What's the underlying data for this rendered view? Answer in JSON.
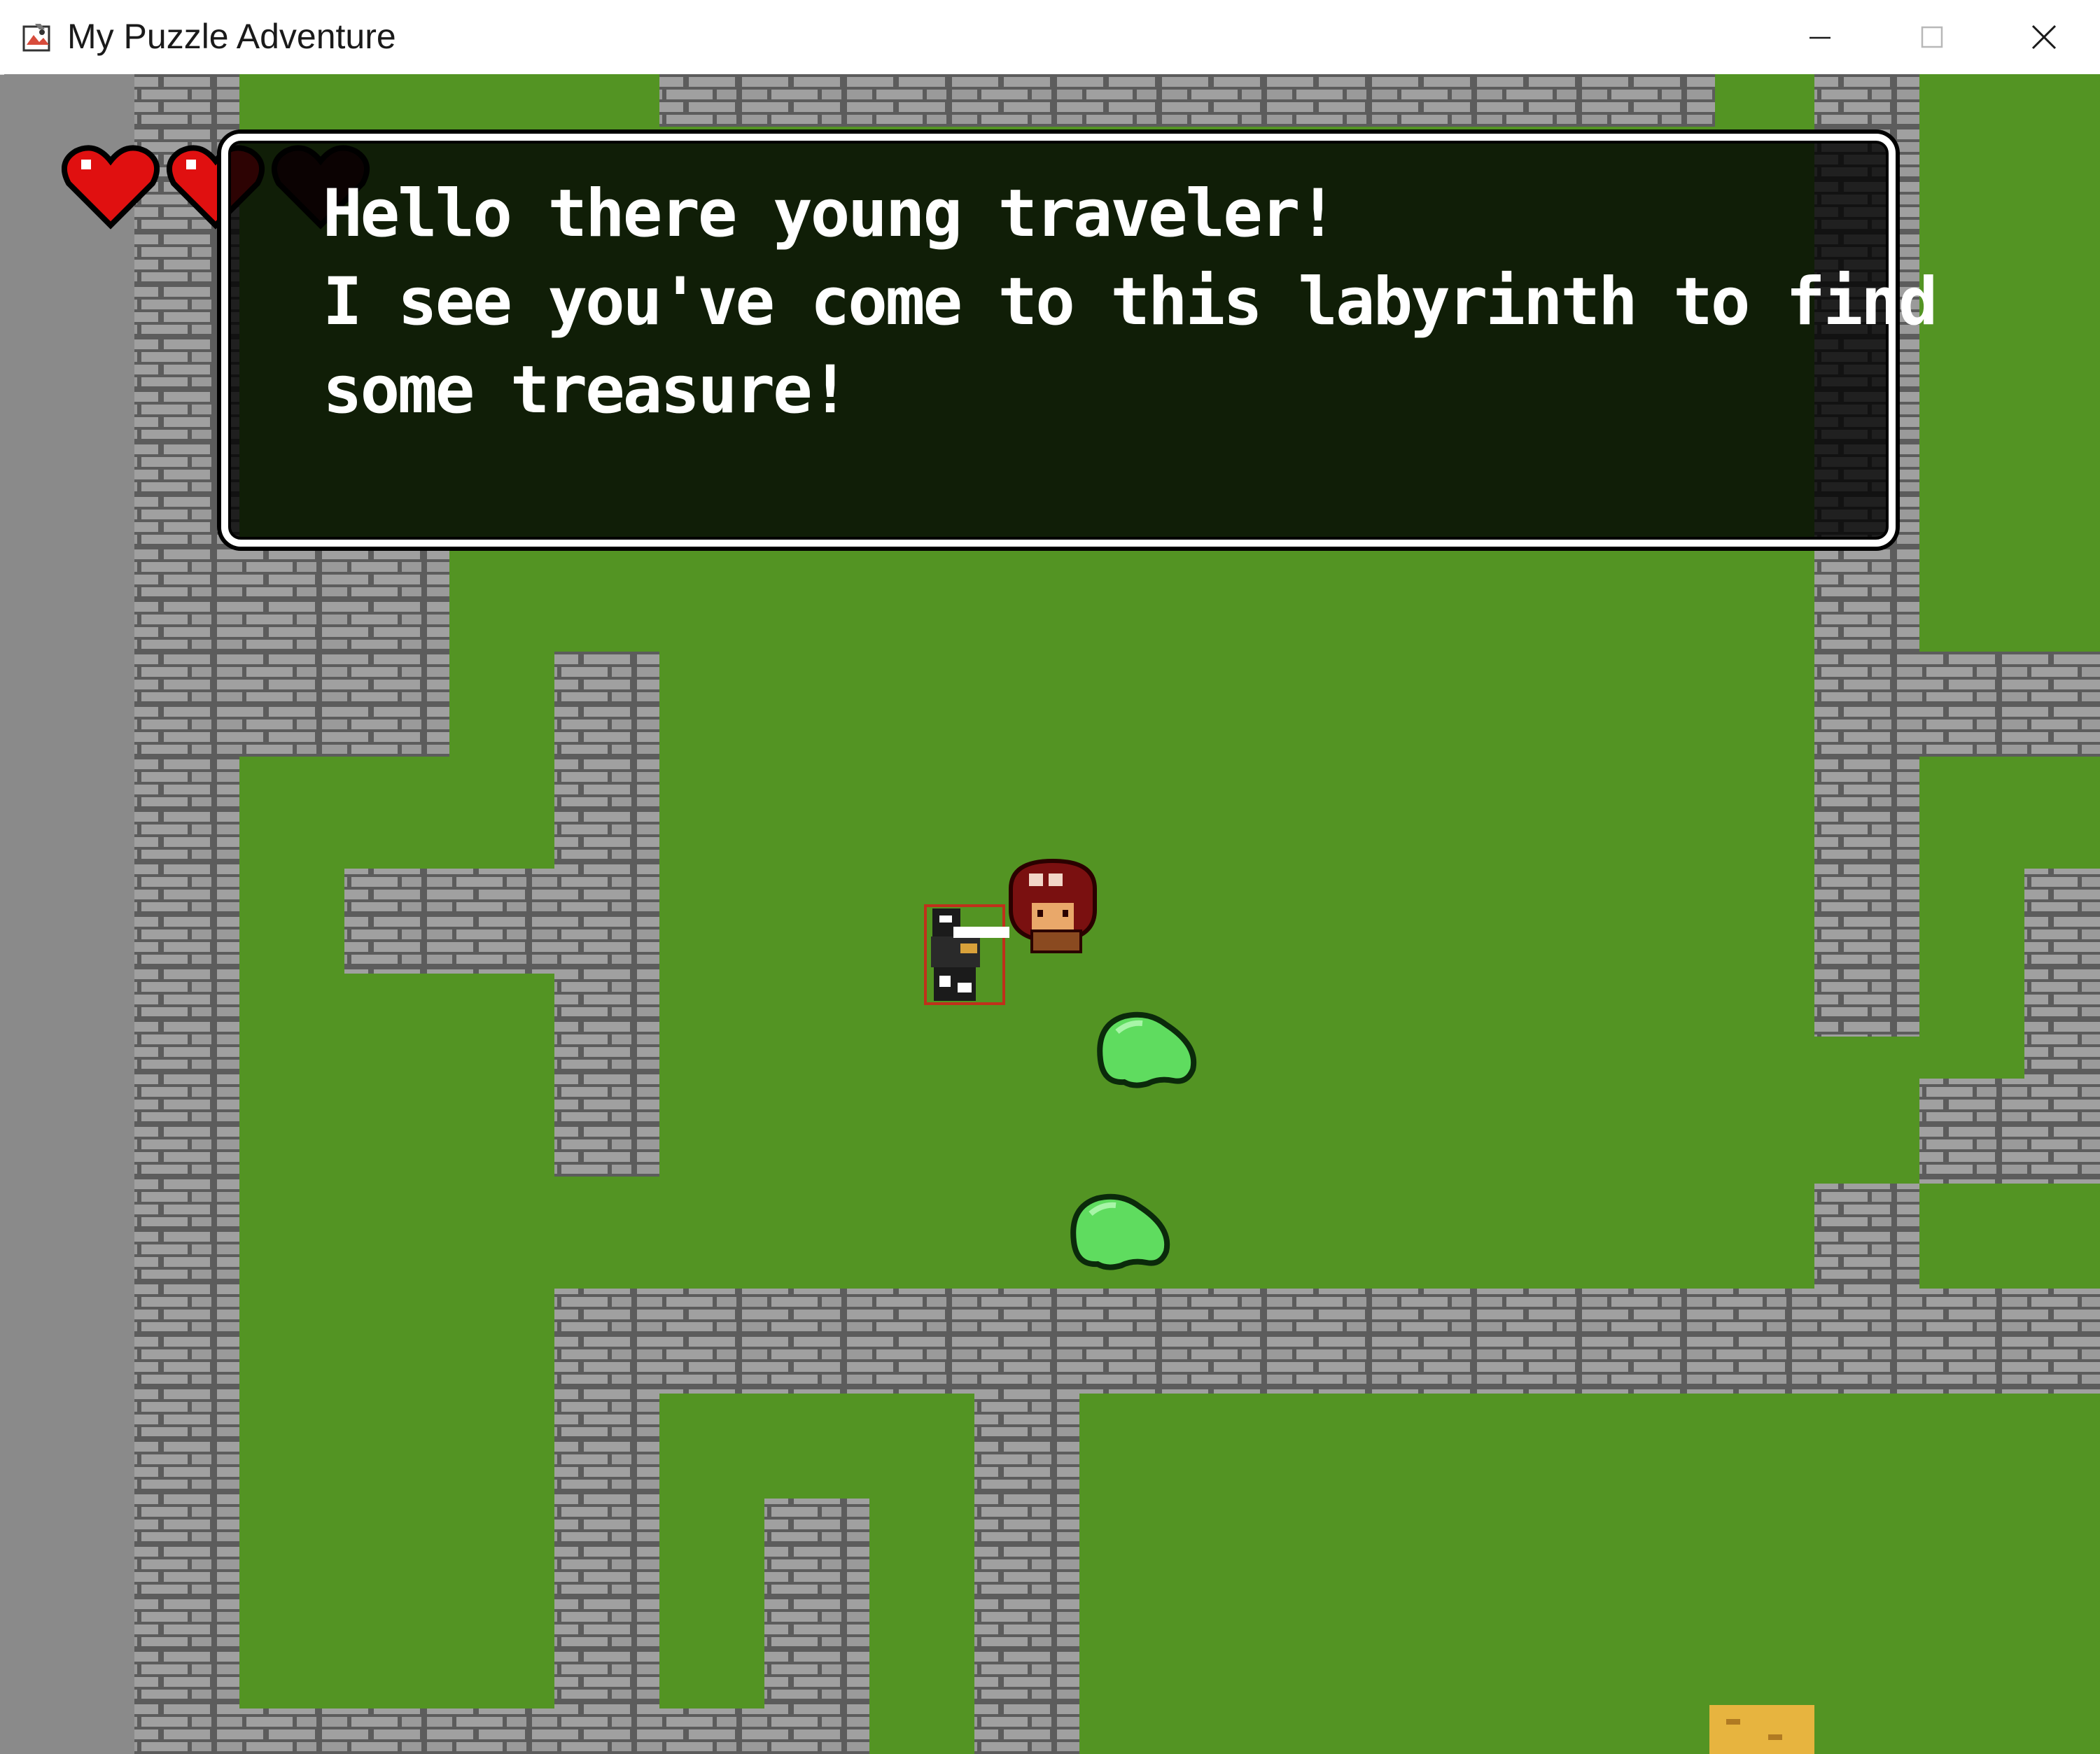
{
  "window": {
    "title": "My Puzzle Adventure",
    "controls": {
      "minimize_icon": "minimize-icon",
      "maximize_icon": "maximize-icon",
      "close_icon": "close-icon"
    }
  },
  "hud": {
    "hearts_total": 3,
    "hearts_filled": 2,
    "heart_color": "#e01010",
    "heart_empty_color": "#3a0a0a"
  },
  "dialog": {
    "lines": [
      "Hello there young traveler!",
      "I see you've come to this labyrinth to find",
      "some treasure!"
    ]
  },
  "colors": {
    "grass": "#539423",
    "wall_light": "#9a9a9a",
    "wall_dark": "#5c5c5c",
    "void": "#8a8a8a",
    "slime": "#5fdc5f",
    "treasure_floor": "#e7b43f"
  },
  "entities": {
    "player_icon": "player-knight-icon",
    "npc_icon": "old-man-npc-icon",
    "slime_icon": "slime-enemy-icon",
    "slime_count": 2,
    "exit_icon": "sand-tile-icon"
  }
}
